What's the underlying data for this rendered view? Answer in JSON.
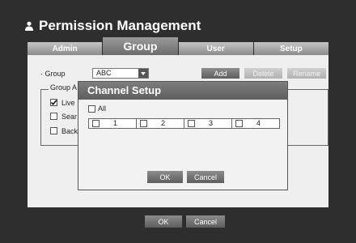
{
  "window": {
    "title": "Permission Management"
  },
  "tabs": [
    {
      "label": "Admin"
    },
    {
      "label": "Group"
    },
    {
      "label": "User"
    },
    {
      "label": "Setup"
    }
  ],
  "group": {
    "label": "· Group",
    "value": "ABC"
  },
  "actions": {
    "add": "Add",
    "delete": "Delete",
    "rename": "Rename"
  },
  "group_authority": {
    "title": "Group A",
    "items": [
      {
        "label": "Live",
        "checked": true
      },
      {
        "label": "Sear",
        "checked": false
      },
      {
        "label": "Back",
        "checked": false
      }
    ]
  },
  "channel_setup": {
    "title": "Channel Setup",
    "all_label": "All",
    "channels": [
      "1",
      "2",
      "3",
      "4"
    ],
    "ok": "OK",
    "cancel": "Cancel"
  },
  "footer": {
    "ok": "OK",
    "cancel": "Cancel"
  }
}
